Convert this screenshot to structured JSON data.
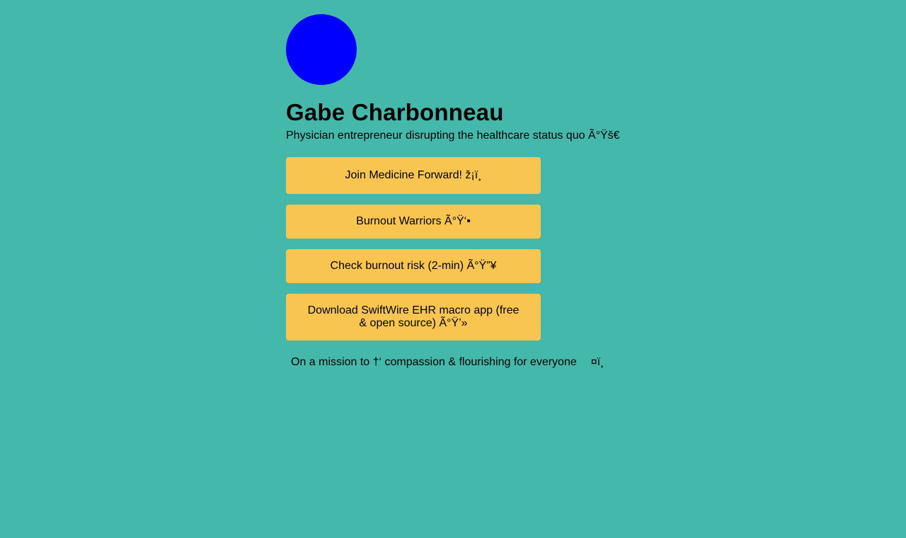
{
  "profile": {
    "avatar_color": "#0000ff",
    "name": "Gabe Charbonneau",
    "bio": "Physician entrepreneur disrupting the healthcare status quo Ã°Ÿš€"
  },
  "links": [
    {
      "label": "Join Medicine Forward! ž¡ï¸"
    },
    {
      "label": "Burnout Warriors Ã°Ÿ‘•"
    },
    {
      "label": "Check burnout risk (2-min) Ã°Ÿ”¥"
    },
    {
      "label": "Download SwiftWire EHR macro app (free & open source) Ã°Ÿ’»"
    }
  ],
  "mission": {
    "text": "On a mission to †‘ compassion & flourishing for everyone",
    "tail": "¤ï¸"
  },
  "colors": {
    "background": "#45b8ac",
    "button": "#f8c550",
    "text": "#000000"
  }
}
